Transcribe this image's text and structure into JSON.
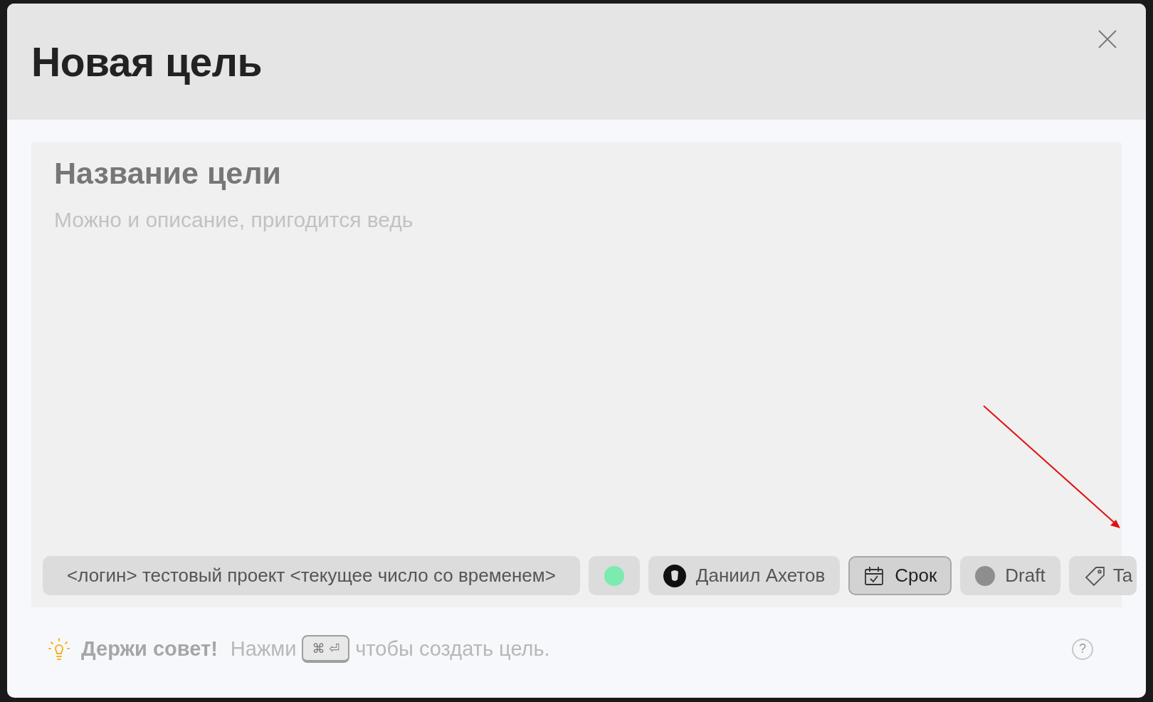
{
  "dialog": {
    "title": "Новая цель"
  },
  "form": {
    "title_placeholder": "Название цели",
    "description_placeholder": "Можно и описание, пригодится ведь"
  },
  "chips": [
    {
      "kind": "project",
      "label": "<логин> тестовый проект <текущее число со временем>",
      "selected": false
    },
    {
      "kind": "state",
      "color": "#7cebaf",
      "selected": false
    },
    {
      "kind": "user",
      "label": "Даниил Ахетов",
      "selected": false
    },
    {
      "kind": "date",
      "label": "Срок",
      "selected": true
    },
    {
      "kind": "status",
      "label": "Draft",
      "color": "#8e8e8e",
      "selected": false
    },
    {
      "kind": "tags",
      "label": "Ta",
      "selected": false
    }
  ],
  "hint": {
    "title": "Держи совет!",
    "before": "Нажми",
    "key": "⌘ ⏎",
    "after": "чтобы создать цель.",
    "help": "?"
  }
}
